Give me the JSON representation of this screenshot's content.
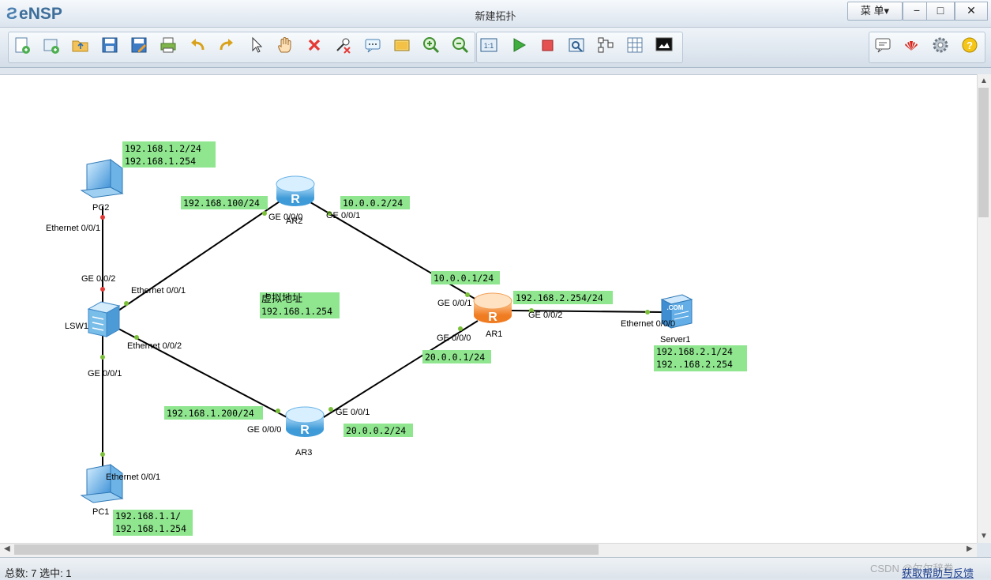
{
  "app": {
    "name": "eNSP",
    "window_title": "新建拓扑",
    "menu_label": "菜 单▾"
  },
  "window_controls": {
    "minimize": "−",
    "maximize": "□",
    "close": "✕"
  },
  "toolbar": {
    "items": [
      "new-topology-icon",
      "new-device-icon",
      "open-folder-icon",
      "save-icon",
      "save-as-icon",
      "print-icon",
      "undo-icon",
      "redo-icon",
      "pointer-icon",
      "hand-pan-icon",
      "delete-icon",
      "delete-link-icon",
      "text-note-icon",
      "rectangle-icon",
      "zoom-in-icon",
      "zoom-out-icon",
      "fit-view-icon",
      "start-device-icon",
      "stop-device-icon",
      "capture-icon",
      "topology-icon",
      "grid-icon",
      "console-icon"
    ],
    "right_items": [
      "chat-icon",
      "huawei-logo-icon",
      "settings-gear-icon",
      "help-icon"
    ]
  },
  "topology": {
    "devices": {
      "pc2": "PC2",
      "pc1": "PC1",
      "lsw1": "LSW1",
      "ar2": "AR2",
      "ar3": "AR3",
      "ar1": "AR1",
      "server1": "Server1"
    },
    "ports": {
      "pc2_eth": "Ethernet 0/0/1",
      "lsw1_ge002": "GE 0/0/2",
      "lsw1_eth001": "Ethernet 0/0/1",
      "lsw1_eth002": "Ethernet 0/0/2",
      "lsw1_ge001": "GE 0/0/1",
      "pc1_eth": "Ethernet 0/0/1",
      "ar2_ge000": "GE 0/0/0",
      "ar2_ge001": "GE 0/0/1",
      "ar1_ge001": "GE 0/0/1",
      "ar1_ge000": "GE 0/0/0",
      "ar1_ge002": "GE 0/0/2",
      "ar3_ge000": "GE 0/0/0",
      "ar3_ge001": "GE 0/0/1",
      "server_eth": "Ethernet 0/0/0"
    },
    "ip_labels": {
      "pc2_ip": "192.168.1.2/24",
      "pc2_gw": "192.168.1.254",
      "ar2_left": "192.168.100/24",
      "ar2_right": "10.0.0.2/24",
      "ar1_top": "10.0.0.1/24",
      "ar1_right": "192.168.2.254/24",
      "ar1_bottom": "20.0.0.1/24",
      "virtual_title": "虚拟地址",
      "virtual_ip": "192.168.1.254",
      "server_ip": "192.168.2.1/24",
      "server_gw": "192..168.2.254",
      "ar3_left": "192.168.1.200/24",
      "ar3_right": "20.0.0.2/24",
      "pc1_ip": "192.168.1.1/",
      "pc1_gw": "192.168.1.254"
    }
  },
  "status": {
    "count": "总数: 7 选中: 1",
    "feedback": "获取帮助与反馈",
    "watermark": "CSDN @尔尔辞卷"
  },
  "colors": {
    "label_bg": "#8fe68f",
    "link": "#000000",
    "port_up": "#7cc03a",
    "port_down": "#e53935"
  }
}
